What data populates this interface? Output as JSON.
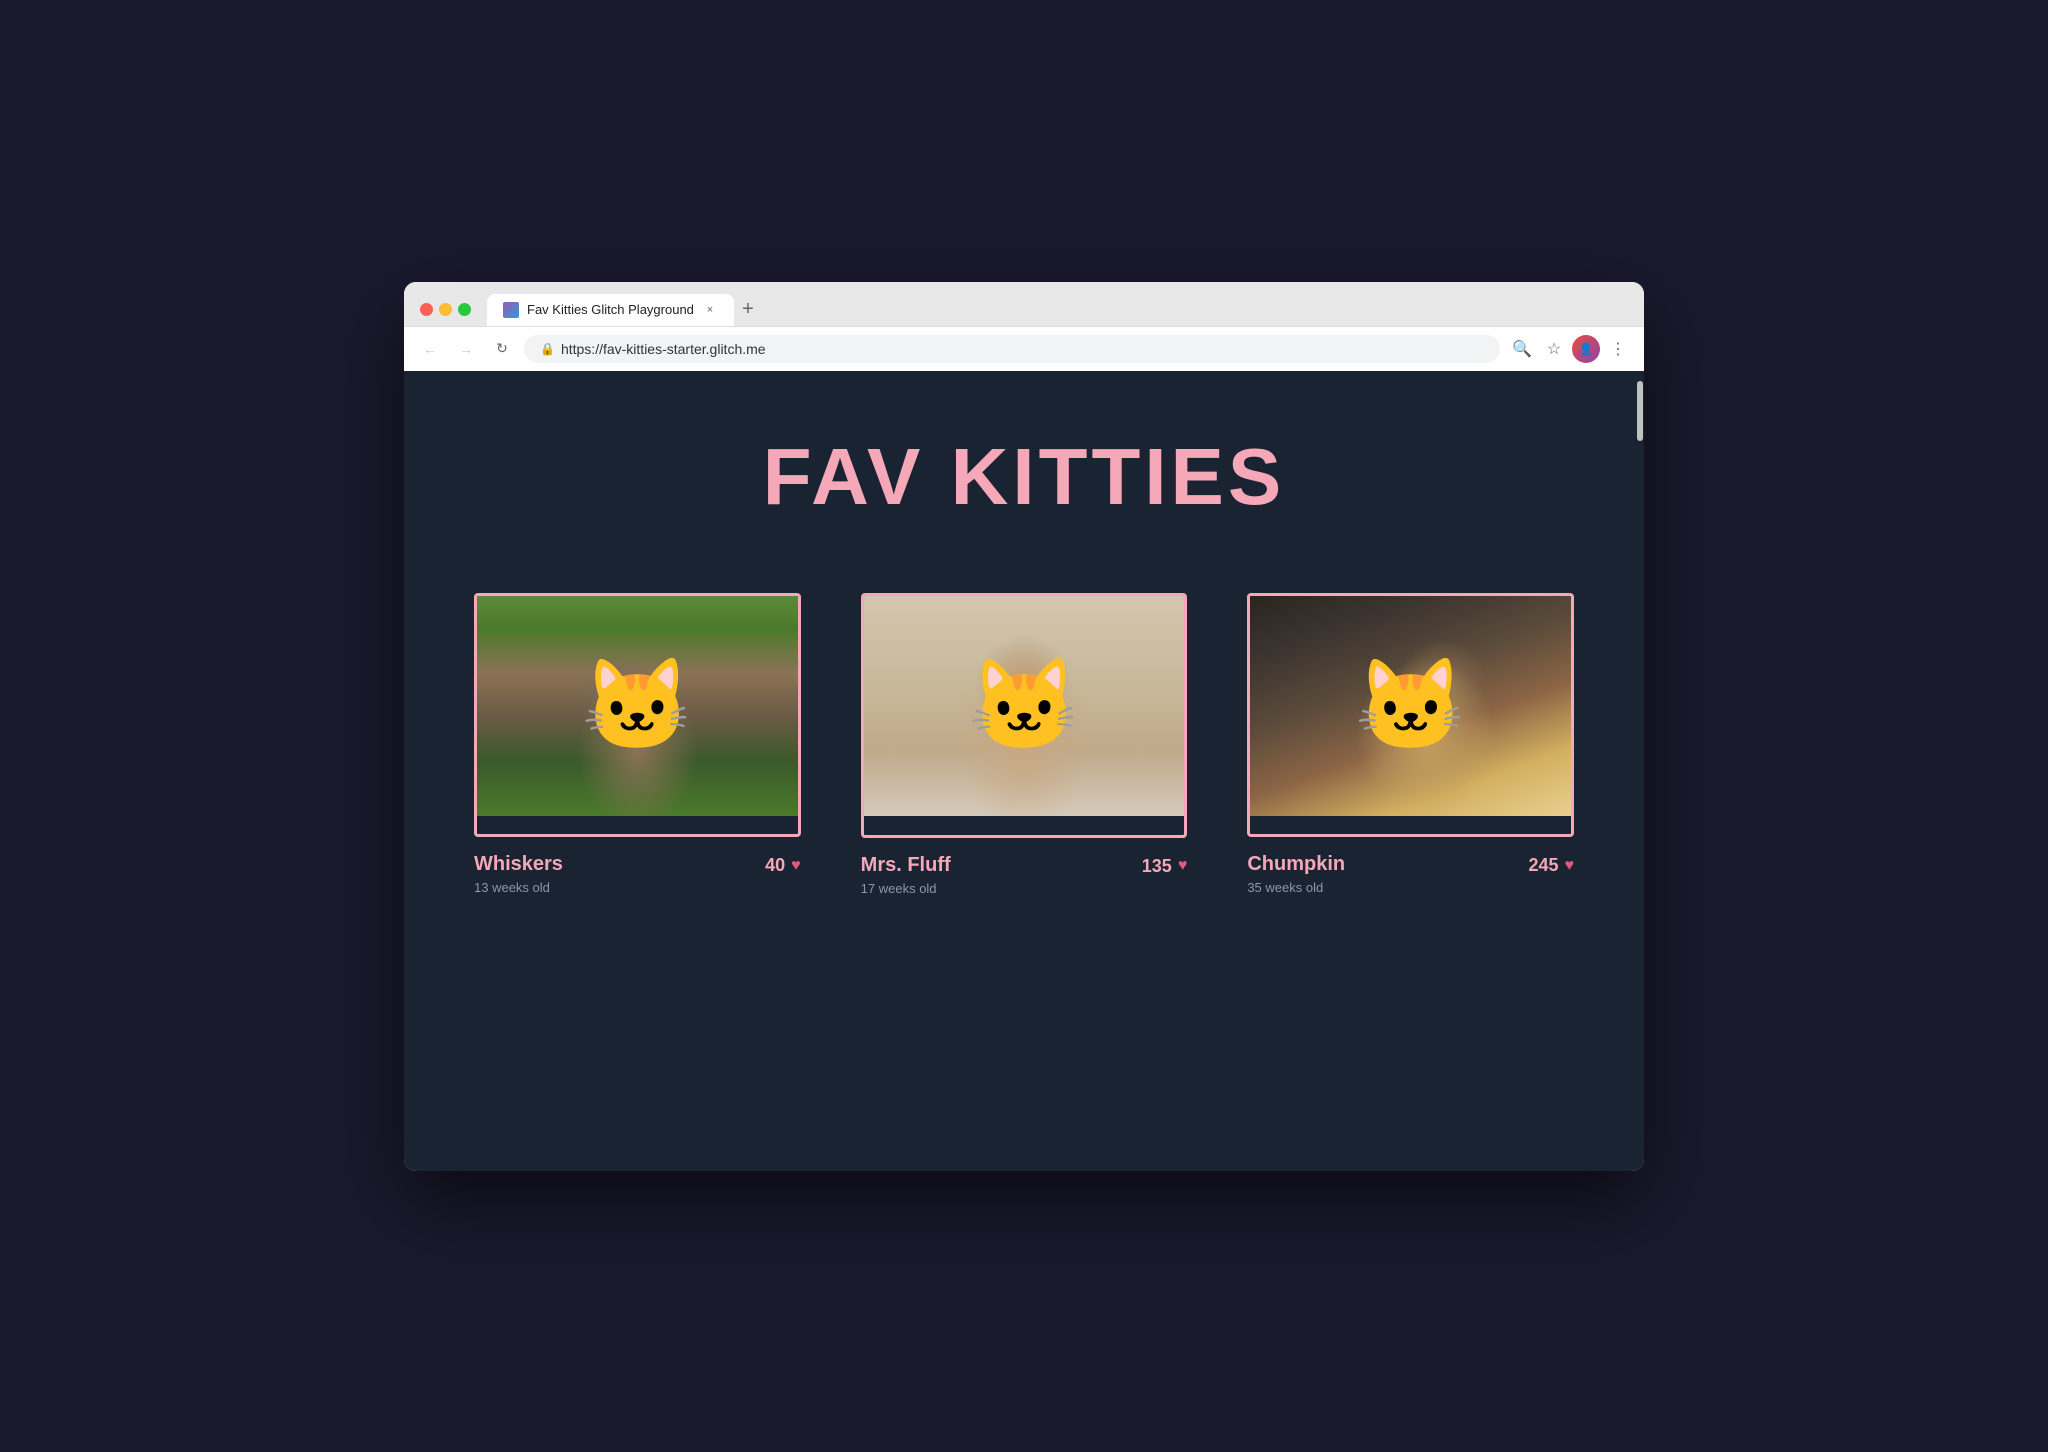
{
  "browser": {
    "tab_title": "Fav Kitties Glitch Playground",
    "tab_close": "×",
    "new_tab": "+",
    "url": "https://fav-kitties-starter.glitch.me",
    "back_btn": "←",
    "forward_btn": "→",
    "refresh_btn": "↻",
    "search_icon": "⌕",
    "bookmark_icon": "☆",
    "menu_icon": "⋮"
  },
  "page": {
    "title": "FAV KITTIES",
    "background_color": "#1a2332",
    "title_color": "#f4a8b8"
  },
  "kitties": [
    {
      "name": "Whiskers",
      "age": "13 weeks old",
      "votes": "40",
      "heart": "♥",
      "image_type": "outdoor"
    },
    {
      "name": "Mrs. Fluff",
      "age": "17 weeks old",
      "votes": "135",
      "heart": "♥",
      "image_type": "sepia"
    },
    {
      "name": "Chumpkin",
      "age": "35 weeks old",
      "votes": "245",
      "heart": "♥",
      "image_type": "tabby"
    }
  ]
}
